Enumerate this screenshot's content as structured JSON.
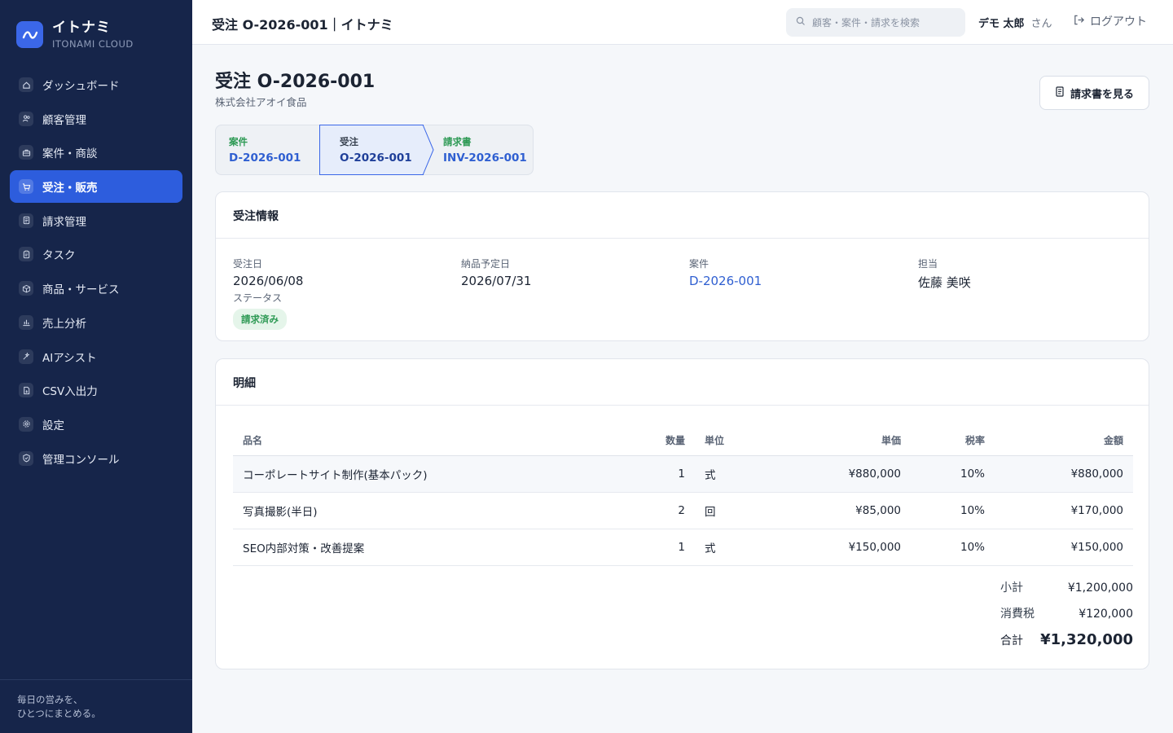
{
  "app": {
    "name": "イトナミ",
    "sub": "ITONAMI CLOUD",
    "accent": "#3b67e8"
  },
  "sidebar": {
    "items": [
      {
        "label": "ダッシュボード",
        "icon": "home-icon"
      },
      {
        "label": "顧客管理",
        "icon": "users-icon"
      },
      {
        "label": "案件・商談",
        "icon": "briefcase-icon"
      },
      {
        "label": "受注・販売",
        "icon": "cart-icon",
        "active": true
      },
      {
        "label": "請求管理",
        "icon": "invoice-icon"
      },
      {
        "label": "タスク",
        "icon": "clipboard-icon"
      },
      {
        "label": "商品・サービス",
        "icon": "box-icon"
      },
      {
        "label": "売上分析",
        "icon": "bar-chart-icon"
      },
      {
        "label": "AIアシスト",
        "icon": "sparkle-icon"
      },
      {
        "label": "CSV入出力",
        "icon": "file-csv-icon"
      },
      {
        "label": "設定",
        "icon": "gear-icon"
      },
      {
        "label": "管理コンソール",
        "icon": "shield-icon"
      }
    ],
    "footer_line1": "毎日の営みを、",
    "footer_line2": "ひとつにまとめる。"
  },
  "header": {
    "title": "受注 O-2026-001｜イトナミ",
    "search_placeholder": "顧客・案件・請求を検索",
    "user_name": "デモ 太郎",
    "user_suffix": "さん",
    "logout_label": "ログアウト"
  },
  "page": {
    "title": "受注 O-2026-001",
    "customer": "株式会社アオイ食品",
    "invoice_button": "請求書を見る"
  },
  "flow": [
    {
      "label": "案件",
      "value": "D-2026-001"
    },
    {
      "label": "受注",
      "value": "O-2026-001"
    },
    {
      "label": "請求書",
      "value": "INV-2026-001"
    }
  ],
  "order_info": {
    "title": "受注情報",
    "order_date_label": "受注日",
    "order_date": "2026/06/08",
    "delivery_label": "納品予定日",
    "delivery_date": "2026/07/31",
    "deal_label": "案件",
    "deal_value": "D-2026-001",
    "owner_label": "担当",
    "owner": "佐藤 美咲",
    "status_label": "ステータス",
    "status": "請求済み"
  },
  "items": {
    "title": "明細",
    "headers": {
      "name": "品名",
      "qty": "数量",
      "unit": "単位",
      "price": "単価",
      "tax": "税率",
      "amount": "金額"
    },
    "rows": [
      {
        "name": "コーポレートサイト制作(基本パック)",
        "qty": "1",
        "unit": "式",
        "price": "¥880,000",
        "tax": "10%",
        "amount": "¥880,000"
      },
      {
        "name": "写真撮影(半日)",
        "qty": "2",
        "unit": "回",
        "price": "¥85,000",
        "tax": "10%",
        "amount": "¥170,000"
      },
      {
        "name": "SEO内部対策・改善提案",
        "qty": "1",
        "unit": "式",
        "price": "¥150,000",
        "tax": "10%",
        "amount": "¥150,000"
      }
    ],
    "subtotal_label": "小計",
    "subtotal": "¥1,200,000",
    "tax_label": "消費税",
    "tax": "¥120,000",
    "total_label": "合計",
    "total": "¥1,320,000"
  }
}
